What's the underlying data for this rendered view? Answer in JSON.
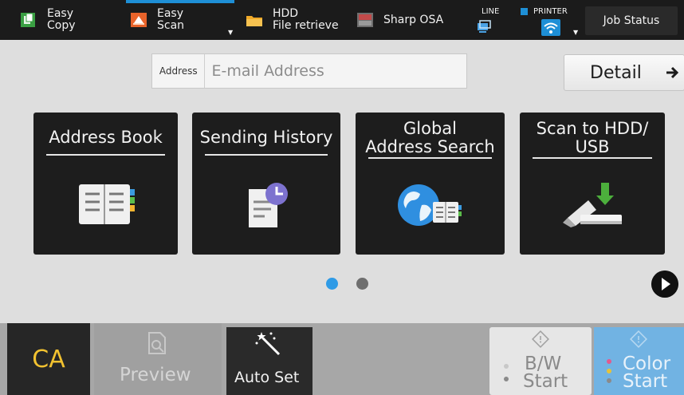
{
  "topbar": {
    "easy_copy": [
      "Easy",
      "Copy"
    ],
    "easy_scan": [
      "Easy",
      "Scan"
    ],
    "hdd_file": [
      "HDD",
      "File retrieve"
    ],
    "sharp_osa": "Sharp OSA",
    "line": "LINE",
    "printer": "PRINTER",
    "job_status": "Job Status"
  },
  "address": {
    "label": "Address",
    "placeholder": "E-mail Address"
  },
  "detail": {
    "label": "Detail"
  },
  "tiles": [
    {
      "title": [
        "Address Book"
      ],
      "icon": "address-book-icon"
    },
    {
      "title": [
        "Sending History"
      ],
      "icon": "sending-history-icon"
    },
    {
      "title": [
        "Global",
        "Address Search"
      ],
      "icon": "globe-icon"
    },
    {
      "title": [
        "Scan to HDD/",
        "USB"
      ],
      "icon": "usb-icon"
    }
  ],
  "paging": {
    "current": 1,
    "total": 2
  },
  "bottom": {
    "ca": "CA",
    "preview": "Preview",
    "auto_set": "Auto Set",
    "bw_start": [
      "B/W",
      "Start"
    ],
    "color_start": [
      "Color",
      "Start"
    ]
  },
  "colors": {
    "accent": "#1e8fd6",
    "tile": "#1d1d1d",
    "ca_text": "#f2c230",
    "color_start": "#71b3e3"
  }
}
